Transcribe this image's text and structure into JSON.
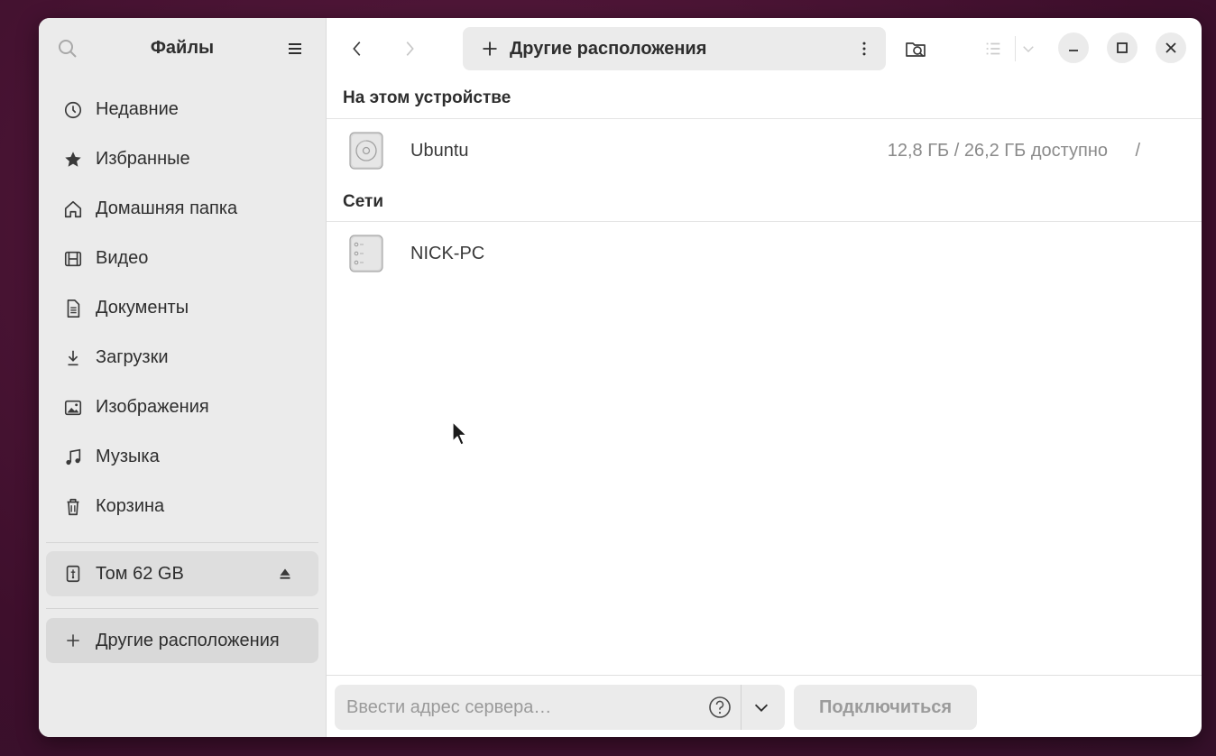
{
  "sidebar": {
    "title": "Файлы",
    "items": [
      {
        "label": "Недавние",
        "icon": "clock-icon"
      },
      {
        "label": "Избранные",
        "icon": "star-icon"
      },
      {
        "label": "Домашняя папка",
        "icon": "home-icon"
      },
      {
        "label": "Видео",
        "icon": "film-icon"
      },
      {
        "label": "Документы",
        "icon": "document-icon"
      },
      {
        "label": "Загрузки",
        "icon": "download-icon"
      },
      {
        "label": "Изображения",
        "icon": "image-icon"
      },
      {
        "label": "Музыка",
        "icon": "music-icon"
      },
      {
        "label": "Корзина",
        "icon": "trash-icon"
      }
    ],
    "volume": {
      "label": "Том 62 GB",
      "icon": "usb-drive-icon"
    },
    "other_locations": {
      "label": "Другие расположения",
      "icon": "plus-icon"
    }
  },
  "toolbar": {
    "path_label": "Другие расположения"
  },
  "main": {
    "on_device_title": "На этом устройстве",
    "devices": [
      {
        "name": "Ubuntu",
        "size": "12,8 ГБ / 26,2 ГБ доступно",
        "mount": "/",
        "icon": "disk-icon"
      }
    ],
    "networks_title": "Сети",
    "networks": [
      {
        "name": "NICK-PC",
        "icon": "server-icon"
      }
    ]
  },
  "connect_bar": {
    "placeholder": "Ввести адрес сервера…",
    "connect_label": "Подключиться"
  },
  "colors": {
    "sidebar_bg": "#ebebeb",
    "window_bg": "#ffffff",
    "desktop_bg": "#4a1434"
  }
}
